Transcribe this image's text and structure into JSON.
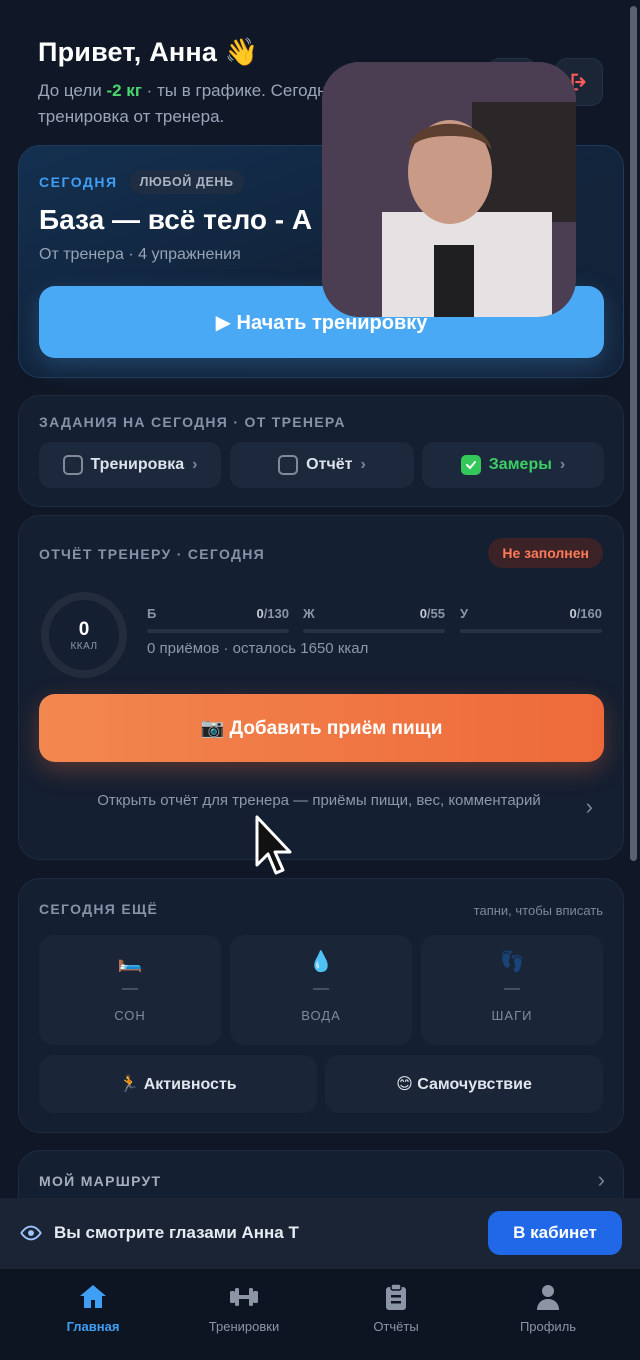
{
  "header": {
    "greeting": "Привет, Анна 👋",
    "subtitle_prefix": "До цели ",
    "subtitle_accent": "-2 кг",
    "subtitle_suffix": " · ты в графике. Сегодня тренировка от тренера."
  },
  "today_workout": {
    "label": "СЕГОДНЯ",
    "chip": "ЛЮБОЙ ДЕНЬ",
    "title": "База — всё тело - А",
    "meta": "От тренера · 4 упражнения",
    "start_button": "▶ Начать тренировку"
  },
  "tasks": {
    "title": "ЗАДАНИЯ НА СЕГОДНЯ · ОТ ТРЕНЕРА",
    "items": [
      {
        "label": "Тренировка",
        "done": false
      },
      {
        "label": "Отчёт",
        "done": false
      },
      {
        "label": "Замеры",
        "done": true
      }
    ]
  },
  "report": {
    "title": "ОТЧЁТ ТРЕНЕРУ · СЕГОДНЯ",
    "status": "Не заполнен",
    "kcal_value": "0",
    "kcal_unit": "ККАЛ",
    "macros": [
      {
        "letter": "Б",
        "value": "0",
        "goal": "/130",
        "progress": 0
      },
      {
        "letter": "Ж",
        "value": "0",
        "goal": "/55",
        "progress": 0
      },
      {
        "letter": "У",
        "value": "0",
        "goal": "/160",
        "progress": 0
      }
    ],
    "note": "0 приёмов · осталось 1650 ккал",
    "add_meal_button": "📷 Добавить приём пищи",
    "open_link": "Открыть отчёт для тренера — приёмы пищи, вес, комментарий"
  },
  "extras": {
    "title": "СЕГОДНЯ ЕЩЁ",
    "hint": "тапни, чтобы вписать",
    "tiles": [
      {
        "icon": "🛏️",
        "value": "—",
        "label": "СОН"
      },
      {
        "icon": "💧",
        "value": "—",
        "label": "ВОДА"
      },
      {
        "icon": "👣",
        "value": "—",
        "label": "ШАГИ"
      }
    ],
    "activity_button": "🏃 Активность",
    "wellbeing_button": "😊 Самочувствие"
  },
  "route": {
    "title": "МОЙ МАРШРУТ"
  },
  "banner": {
    "text": "Вы смотрите глазами Анна Т",
    "button": "В кабинет"
  },
  "tabs": [
    {
      "label": "Главная",
      "icon": "home-icon"
    },
    {
      "label": "Тренировки",
      "icon": "dumbbell-icon"
    },
    {
      "label": "Отчёты",
      "icon": "clipboard-icon"
    },
    {
      "label": "Профиль",
      "icon": "person-icon"
    }
  ],
  "colors": {
    "accent_blue": "#3f9ff5",
    "accent_orange": "#ee6a3a",
    "success_green": "#34c759",
    "background": "#101827"
  }
}
